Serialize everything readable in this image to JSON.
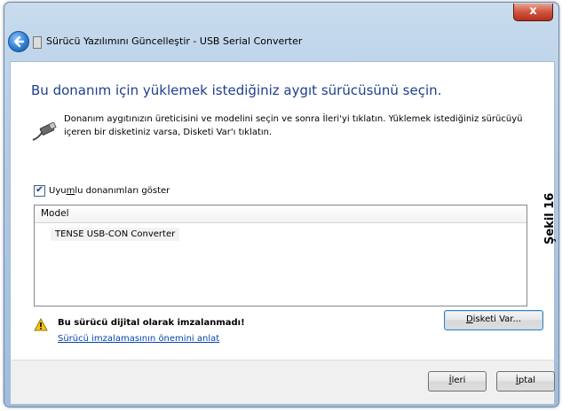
{
  "window": {
    "title": "Sürücü Yazılımını Güncelleştir - USB Serial Converter",
    "close_label": "x"
  },
  "main": {
    "heading": "Bu donanım için yüklemek istediğiniz aygıt sürücüsünü seçin.",
    "description": "Donanım aygıtınızın üreticisini ve modelini seçin ve sonra İleri'yi tıklatın. Yüklemek istediğiniz sürücüyü içeren bir disketiniz varsa, Disketi Var'ı tıklatın.",
    "checkbox": {
      "label_pre": "Uyu",
      "label_ul": "m",
      "label_post": "lu donanımları göster",
      "checked": true
    },
    "model_list": {
      "header": "Model",
      "items": [
        "TENSE USB-CON Converter"
      ]
    },
    "warning": {
      "title": "Bu sürücü dijital olarak imzalanmadı!",
      "link": "Sürücü imzalamasının önemini anlat"
    },
    "have_disk_button": {
      "ul": "D",
      "rest": "isketi Var..."
    }
  },
  "footer": {
    "next_button": {
      "ul": "İ",
      "rest": "leri"
    },
    "cancel_button": {
      "ul": "İ",
      "rest": "ptal"
    }
  },
  "side_caption": "Şekil 16"
}
